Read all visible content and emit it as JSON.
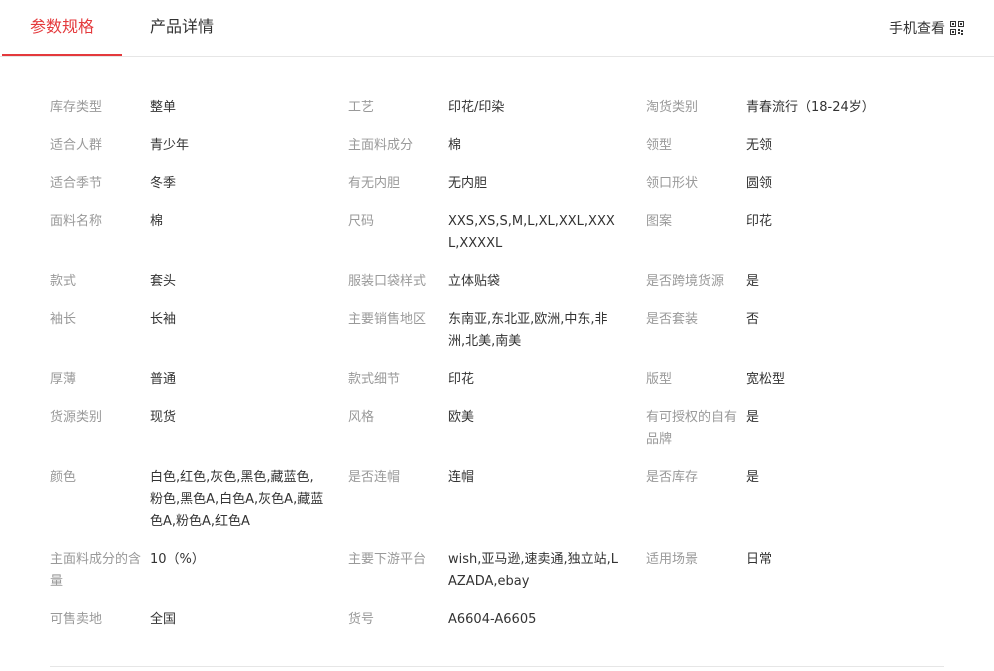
{
  "tabs": {
    "specs_label": "参数规格",
    "details_label": "产品详情"
  },
  "header": {
    "mobile_view_label": "手机查看"
  },
  "icons": {
    "qr": "qr-code-icon"
  },
  "colors": {
    "accent": "#e4393c",
    "label": "#999999",
    "value": "#333333",
    "divider": "#e6e6e6"
  },
  "specs": [
    [
      {
        "label": "库存类型",
        "value": "整单"
      },
      {
        "label": "工艺",
        "value": "印花/印染"
      },
      {
        "label": "淘货类别",
        "value": "青春流行（18-24岁）"
      }
    ],
    [
      {
        "label": "适合人群",
        "value": "青少年"
      },
      {
        "label": "主面料成分",
        "value": "棉"
      },
      {
        "label": "领型",
        "value": "无领"
      }
    ],
    [
      {
        "label": "适合季节",
        "value": "冬季"
      },
      {
        "label": "有无内胆",
        "value": "无内胆"
      },
      {
        "label": "领口形状",
        "value": "圆领"
      }
    ],
    [
      {
        "label": "面料名称",
        "value": "棉"
      },
      {
        "label": "尺码",
        "value": "XXS,XS,S,M,L,XL,XXL,XXXL,XXXXL"
      },
      {
        "label": "图案",
        "value": "印花"
      }
    ],
    [
      {
        "label": "款式",
        "value": "套头"
      },
      {
        "label": "服装口袋样式",
        "value": "立体贴袋"
      },
      {
        "label": "是否跨境货源",
        "value": "是"
      }
    ],
    [
      {
        "label": "袖长",
        "value": "长袖"
      },
      {
        "label": "主要销售地区",
        "value": "东南亚,东北亚,欧洲,中东,非洲,北美,南美"
      },
      {
        "label": "是否套装",
        "value": "否"
      }
    ],
    [
      {
        "label": "厚薄",
        "value": "普通"
      },
      {
        "label": "款式细节",
        "value": "印花"
      },
      {
        "label": "版型",
        "value": "宽松型"
      }
    ],
    [
      {
        "label": "货源类别",
        "value": "现货"
      },
      {
        "label": "风格",
        "value": "欧美"
      },
      {
        "label": "有可授权的自有品牌",
        "value": "是"
      }
    ],
    [
      {
        "label": "颜色",
        "value": "白色,红色,灰色,黑色,藏蓝色,粉色,黑色A,白色A,灰色A,藏蓝色A,粉色A,红色A"
      },
      {
        "label": "是否连帽",
        "value": "连帽"
      },
      {
        "label": "是否库存",
        "value": "是"
      }
    ],
    [
      {
        "label": "主面料成分的含量",
        "value": "10（%）"
      },
      {
        "label": "主要下游平台",
        "value": "wish,亚马逊,速卖通,独立站,LAZADA,ebay"
      },
      {
        "label": "适用场景",
        "value": "日常"
      }
    ],
    [
      {
        "label": "可售卖地",
        "value": "全国"
      },
      {
        "label": "货号",
        "value": "A6604-A6605"
      }
    ]
  ]
}
